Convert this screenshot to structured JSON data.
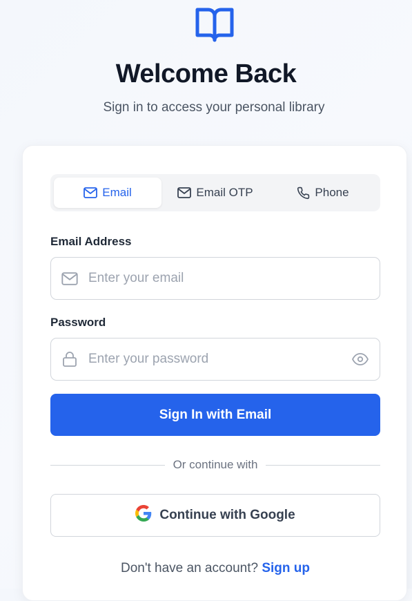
{
  "header": {
    "logo_icon": "open-book-icon",
    "title": "Welcome Back",
    "subtitle": "Sign in to access your personal library"
  },
  "tabs": [
    {
      "label": "Email",
      "icon": "mail-icon",
      "active": true
    },
    {
      "label": "Email OTP",
      "icon": "mail-icon",
      "active": false
    },
    {
      "label": "Phone",
      "icon": "phone-icon",
      "active": false
    }
  ],
  "form": {
    "email_label": "Email Address",
    "email_placeholder": "Enter your email",
    "password_label": "Password",
    "password_placeholder": "Enter your password",
    "submit_label": "Sign In with Email"
  },
  "divider_text": "Or continue with",
  "google_label": "Continue with Google",
  "footer": {
    "prompt": "Don't have an account?",
    "link": "Sign up"
  },
  "colors": {
    "accent": "#2563eb",
    "text": "#111827",
    "muted": "#6b7280"
  }
}
